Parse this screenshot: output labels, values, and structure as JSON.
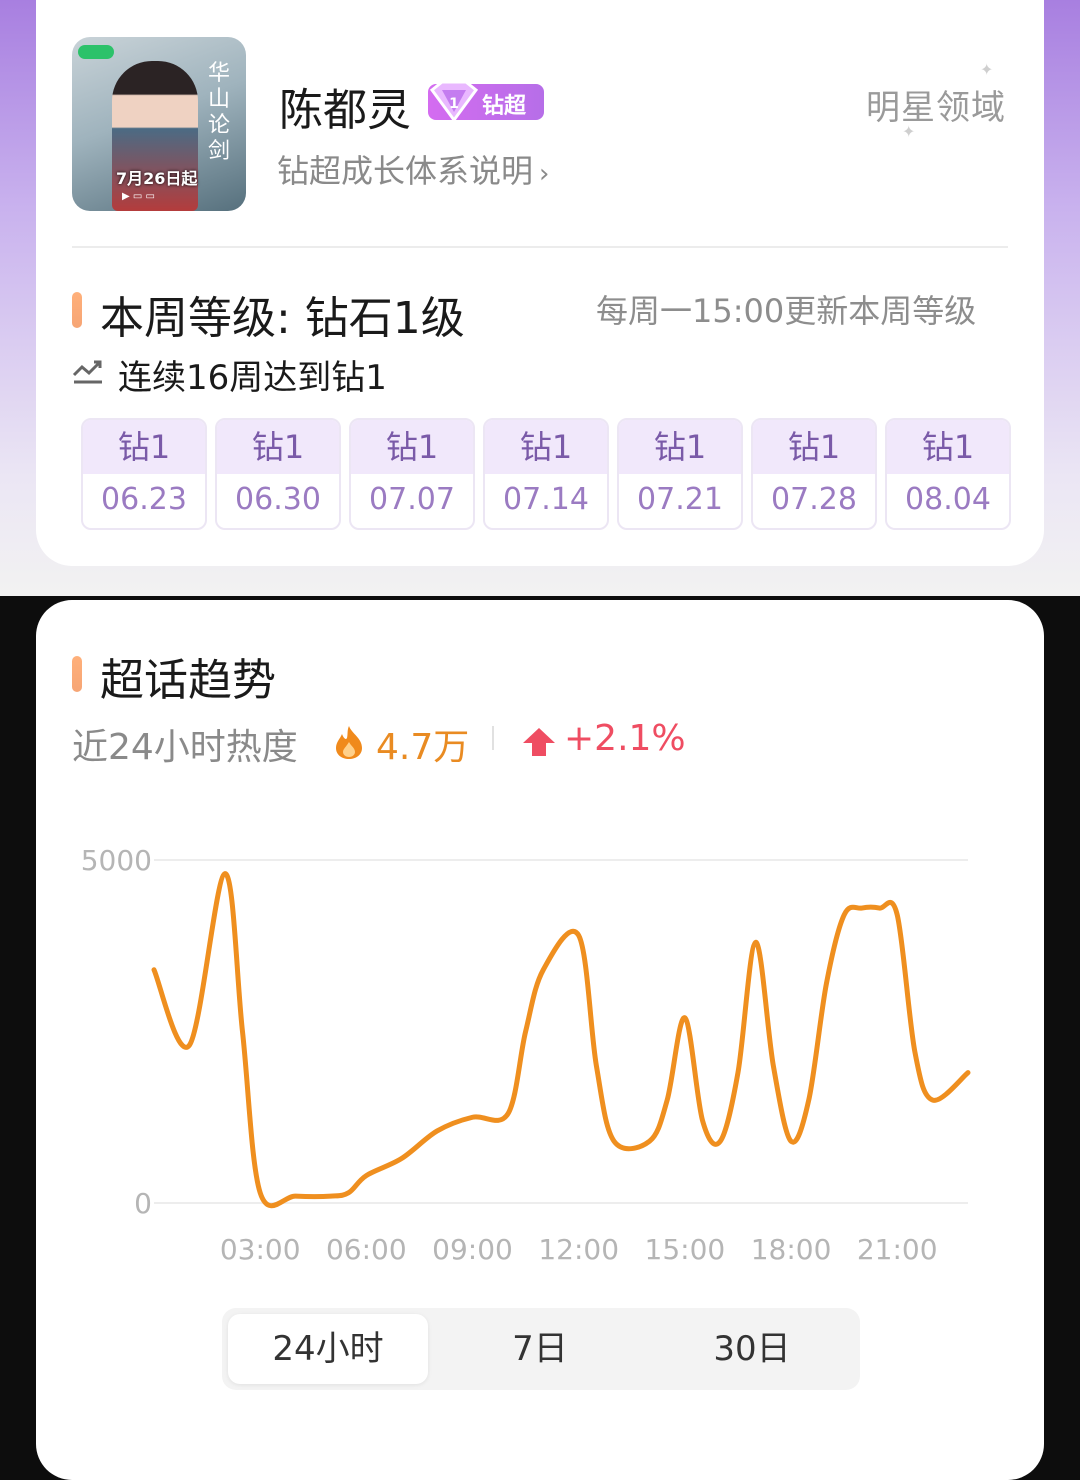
{
  "profile": {
    "name": "陈都灵",
    "tag": "钻超",
    "growth_link": "钻超成长体系说明",
    "domain": "明星领域",
    "poster": {
      "date_text": "7月26日起",
      "calligraphy": "华山论剑"
    }
  },
  "level": {
    "title": "本周等级: 钻石1级",
    "update_note": "每周一15:00更新本周等级",
    "streak": "连续16周达到钻1",
    "weeks": [
      {
        "level": "钻1",
        "date": "06.23"
      },
      {
        "level": "钻1",
        "date": "06.30"
      },
      {
        "level": "钻1",
        "date": "07.07"
      },
      {
        "level": "钻1",
        "date": "07.14"
      },
      {
        "level": "钻1",
        "date": "07.21"
      },
      {
        "level": "钻1",
        "date": "07.28"
      },
      {
        "level": "钻1",
        "date": "08.04"
      }
    ]
  },
  "trend": {
    "title": "超话趋势",
    "heat_label": "近24小时热度",
    "heat_value": "4.7万",
    "change": "+2.1%",
    "tabs": [
      "24小时",
      "7日",
      "30日"
    ],
    "active_tab": "24小时"
  },
  "colors": {
    "accent_orange": "#e98b22",
    "line": "#ef8f1f",
    "up_red": "#ef4d62",
    "purple": "#b66ee8"
  },
  "chart_data": {
    "type": "line",
    "x_tick_labels": [
      "03:00",
      "06:00",
      "09:00",
      "12:00",
      "15:00",
      "18:00",
      "21:00"
    ],
    "y_tick_labels": [
      "0",
      "5000"
    ],
    "ylim": [
      0,
      5000
    ],
    "xlim": [
      0,
      23
    ],
    "series": [
      {
        "x": [
          0,
          1,
          2,
          2.5,
          3,
          4,
          5,
          5.5,
          6,
          7,
          8,
          9,
          10,
          10.5,
          11,
          12,
          12.5,
          13,
          14,
          14.5,
          15,
          15.5,
          16,
          16.5,
          17,
          17.5,
          18,
          18.5,
          19,
          19.5,
          20,
          20.5,
          21,
          21.5,
          22,
          23
        ],
        "y": [
          3400,
          2300,
          4800,
          2500,
          150,
          100,
          100,
          150,
          400,
          650,
          1050,
          1250,
          1300,
          2500,
          3400,
          3900,
          2000,
          900,
          900,
          1500,
          2700,
          1200,
          900,
          1900,
          3800,
          2000,
          900,
          1500,
          3200,
          4200,
          4300,
          4300,
          4200,
          2200,
          1500,
          1900
        ]
      }
    ]
  }
}
